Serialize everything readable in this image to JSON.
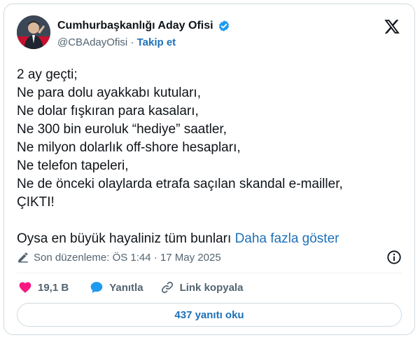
{
  "account": {
    "name": "Cumhurbaşkanlığı Aday Ofisi",
    "handle": "@CBAdayOfisi",
    "separator": "·",
    "follow_label": "Takip et"
  },
  "post": {
    "lines": [
      "2 ay geçti;",
      "Ne para dolu ayakkabı kutuları,",
      "Ne dolar fışkıran para kasaları,",
      "Ne 300 bin euroluk “hediye” saatler,",
      "Ne milyon dolarlık off-shore hesapları,",
      "Ne telefon tapeleri,",
      "Ne de önceki olaylarda etrafa saçılan skandal e-mailler,",
      "ÇIKTI!",
      "",
      "Oysa en büyük hayaliniz tüm bunları"
    ],
    "show_more_label": "Daha fazla göster",
    "edited_label": "Son düzenleme: ÖS 1:44 · 17 May 2025"
  },
  "actions": {
    "likes": "19,1 B",
    "reply_label": "Yanıtla",
    "copy_link_label": "Link kopyala"
  },
  "replies_button_label": "437 yanıtı oku",
  "colors": {
    "accent": "#1d70b8",
    "verified": "#1d9bf0",
    "like": "#f91880",
    "reply_icon": "#1d9bf0",
    "secondary_text": "#536471",
    "border": "#cfd9de"
  },
  "icons": {
    "verified": "verified-badge-icon",
    "logo": "x-logo-icon",
    "edit": "pencil-icon",
    "info": "info-icon",
    "like": "heart-icon",
    "reply": "speech-bubble-icon",
    "link": "link-icon"
  }
}
